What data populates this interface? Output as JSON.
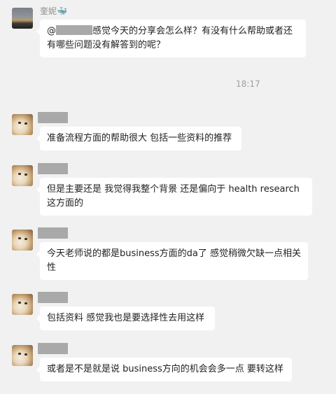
{
  "chat": {
    "timestamp": "18:17",
    "messages": [
      {
        "sender_name": "奎妮",
        "sender_badge": "🐳",
        "mention": "@",
        "text": "感觉今天的分享会怎么样？有没有什么帮助或者还有哪些问题没有解答到的呢？"
      },
      {
        "text": "准备流程方面的帮助很大 包括一些资料的推荐"
      },
      {
        "text": "但是主要还是 我觉得我整个背景 还是偏向于 health research这方面的"
      },
      {
        "text": "今天老师说的都是business方面的da了 感觉稍微欠缺一点相关性"
      },
      {
        "text": "包括资料 感觉我也是要选择性去用这样"
      },
      {
        "text": "或者是不是就是说 business方向的机会会多一点 要转这样"
      }
    ]
  }
}
